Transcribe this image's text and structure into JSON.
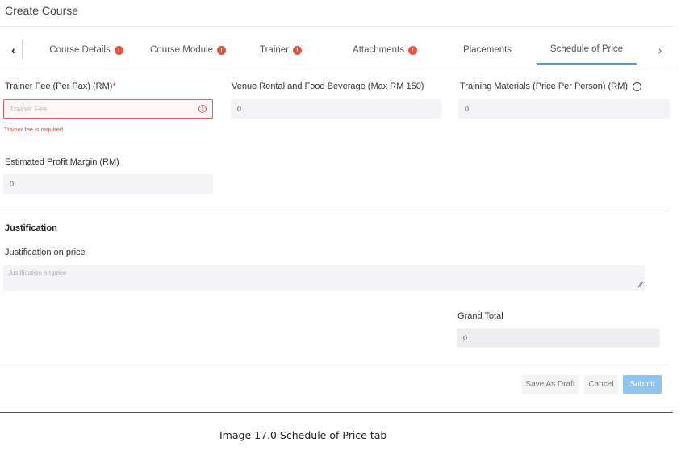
{
  "page": {
    "title": "Create Course"
  },
  "tabs": [
    {
      "label": "Course Details",
      "warning": true
    },
    {
      "label": "Course Module",
      "warning": true
    },
    {
      "label": "Trainer",
      "warning": true
    },
    {
      "label": "Attachments",
      "warning": true
    },
    {
      "label": "Placements",
      "warning": false
    },
    {
      "label": "Schedule of Price",
      "warning": false,
      "active": true
    }
  ],
  "nav": {
    "prev_icon": "chevron-left-icon",
    "next_icon": "chevron-right-icon",
    "prev_glyph": "‹",
    "next_glyph": "›",
    "warning_glyph": "!"
  },
  "form": {
    "trainer_fee": {
      "label": "Trainer Fee (Per Pax) (RM)",
      "required_mark": "*",
      "value": "",
      "placeholder": "Trainer Fee",
      "error": "Trainer fee is required",
      "error_glyph": "!"
    },
    "venue_rental": {
      "label": "Venue Rental and Food Beverage (Max RM 150)",
      "value": "0"
    },
    "training_materials": {
      "label": "Training Materials (Price Per Person) (RM)",
      "info_glyph": "i",
      "value": "0"
    },
    "profit_margin": {
      "label": "Estimated Profit Margin (RM)",
      "value": "0"
    }
  },
  "justification": {
    "section_title": "Justification",
    "label": "Justification on price",
    "placeholder": "Justification on price",
    "resize_glyph": "⁄⁄"
  },
  "grand_total": {
    "label": "Grand Total",
    "value": "0"
  },
  "actions": {
    "save_draft": "Save As Draft",
    "cancel": "Cancel",
    "submit": "Submit"
  },
  "caption": "Image 17.0 Schedule of Price tab",
  "colors": {
    "error": "#e04a4a",
    "active_tab": "#5b9bd5",
    "submit": "#8ec4f0",
    "field_bg": "#f2f4f7"
  }
}
